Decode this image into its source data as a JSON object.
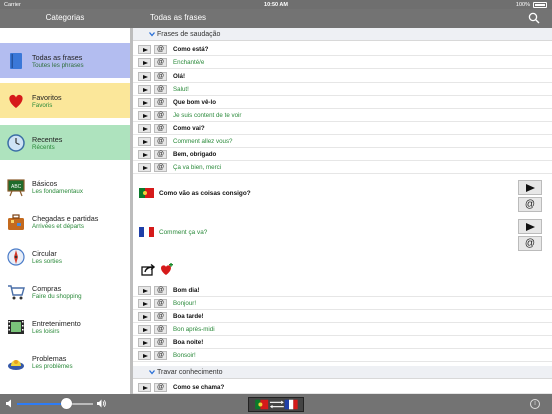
{
  "status": {
    "carrier": "Carrier",
    "time": "10:50 AM",
    "battery": "100%"
  },
  "nav": {
    "left_title": "Categorias",
    "right_title": "Todas as frases",
    "search_icon": "search-icon"
  },
  "categories": [
    {
      "title": "Todas as frases",
      "subtitle": "Toutes les phrases",
      "icon": "book-icon",
      "bg": "#b3bdf0"
    },
    {
      "title": "Favoritos",
      "subtitle": "Favoris",
      "icon": "heart-icon",
      "bg": "#fbe79a"
    },
    {
      "title": "Recentes",
      "subtitle": "Récents",
      "icon": "clock-icon",
      "bg": "#aee3be"
    },
    {
      "title": "Básicos",
      "subtitle": "Les fondamentaux",
      "icon": "chalkboard-icon"
    },
    {
      "title": "Chegadas e partidas",
      "subtitle": "Arrivées et départs",
      "icon": "suitcase-icon"
    },
    {
      "title": "Circular",
      "subtitle": "Les sorties",
      "icon": "compass-icon"
    },
    {
      "title": "Compras",
      "subtitle": "Faire du shopping",
      "icon": "cart-icon"
    },
    {
      "title": "Entretenimento",
      "subtitle": "Les loisirs",
      "icon": "film-icon"
    },
    {
      "title": "Problemas",
      "subtitle": "Les problèmes",
      "icon": "siren-icon"
    }
  ],
  "sections": [
    {
      "label": "Frases de saudação"
    },
    {
      "label": "Travar conhecimento"
    }
  ],
  "phrases": [
    {
      "pt": "Como está?",
      "fr": "Enchanté/e"
    },
    {
      "pt": "Olá!",
      "fr": "Salut!"
    },
    {
      "pt": "Que bom vê-lo",
      "fr": "Je suis content de te voir"
    },
    {
      "pt": "Como vai?",
      "fr": "Comment allez vous?"
    },
    {
      "pt": "Bem, obrigado",
      "fr": "Ça va bien, merci"
    }
  ],
  "expanded": {
    "pt": "Como vão as coisas consigo?",
    "fr": "Comment ça va?"
  },
  "phrases2": [
    {
      "pt": "Bom dia!",
      "fr": "Bonjour!"
    },
    {
      "pt": "Boa tarde!",
      "fr": "Bon après-midi"
    },
    {
      "pt": "Boa noite!",
      "fr": "Bonsoir!"
    }
  ],
  "phrases3": [
    {
      "pt": "Como se chama?"
    }
  ],
  "bottom": {
    "volume_level": 0.65,
    "info_label": "i"
  },
  "colors": {
    "bar": "#737373",
    "sidebar_active": "#b3bdf0",
    "fr_text": "#2a8a3a",
    "slider_fill": "#2d7cf6"
  }
}
